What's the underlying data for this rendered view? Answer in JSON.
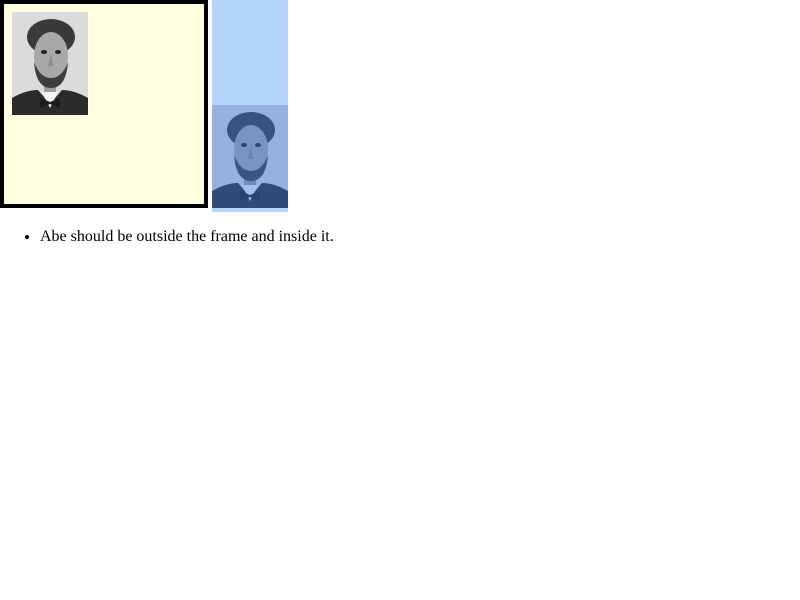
{
  "icons": {
    "portrait": "lincoln-portrait-icon"
  },
  "colors": {
    "frame_background": "#ffffe0",
    "frame_border": "#000000",
    "selection_highlight": "#b3d4fc"
  },
  "notes": [
    "Abe should be outside the frame and inside it."
  ]
}
